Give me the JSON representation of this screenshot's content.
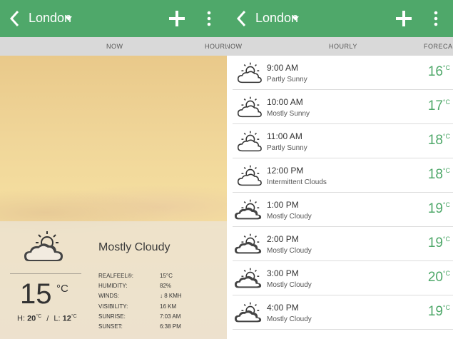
{
  "left": {
    "city": "London",
    "tabs": {
      "now": "NOW",
      "hourly_partial": "HOURLY"
    },
    "now": {
      "condition": "Mostly Cloudy",
      "temp": "15",
      "unit": "°C",
      "hi_label": "H:",
      "hi": "20",
      "lo_label": "L:",
      "lo": "12",
      "deg_unit": "°C",
      "details": [
        {
          "label": "REALFEEL®:",
          "value": "15°C"
        },
        {
          "label": "HUMIDITY:",
          "value": "82%"
        },
        {
          "label": "WINDS:",
          "value": "↓ 8 KMH"
        },
        {
          "label": "VISIBILITY:",
          "value": "16 KM"
        },
        {
          "label": "SUNRISE:",
          "value": "7:03 AM"
        },
        {
          "label": "SUNSET:",
          "value": "6:38 PM"
        }
      ]
    }
  },
  "right": {
    "city": "London",
    "tabs": {
      "now_partial": "NOW",
      "hourly": "HOURLY",
      "forecast_partial": "FORECAS"
    },
    "unit": "°C",
    "hours": [
      {
        "time": "9:00 AM",
        "desc": "Partly Sunny",
        "temp": "16",
        "icon": "partly-sunny-icon"
      },
      {
        "time": "10:00 AM",
        "desc": "Mostly Sunny",
        "temp": "17",
        "icon": "mostly-sunny-icon"
      },
      {
        "time": "11:00 AM",
        "desc": "Partly Sunny",
        "temp": "18",
        "icon": "partly-sunny-icon"
      },
      {
        "time": "12:00 PM",
        "desc": "Intermittent Clouds",
        "temp": "18",
        "icon": "intermittent-clouds-icon"
      },
      {
        "time": "1:00 PM",
        "desc": "Mostly Cloudy",
        "temp": "19",
        "icon": "mostly-cloudy-icon"
      },
      {
        "time": "2:00 PM",
        "desc": "Mostly Cloudy",
        "temp": "19",
        "icon": "mostly-cloudy-icon"
      },
      {
        "time": "3:00 PM",
        "desc": "Mostly Cloudy",
        "temp": "20",
        "icon": "mostly-cloudy-icon"
      },
      {
        "time": "4:00 PM",
        "desc": "Mostly Cloudy",
        "temp": "19",
        "icon": "mostly-cloudy-icon"
      }
    ]
  },
  "colors": {
    "accent": "#4fa86a",
    "tab_bar": "#d9d9d9"
  }
}
